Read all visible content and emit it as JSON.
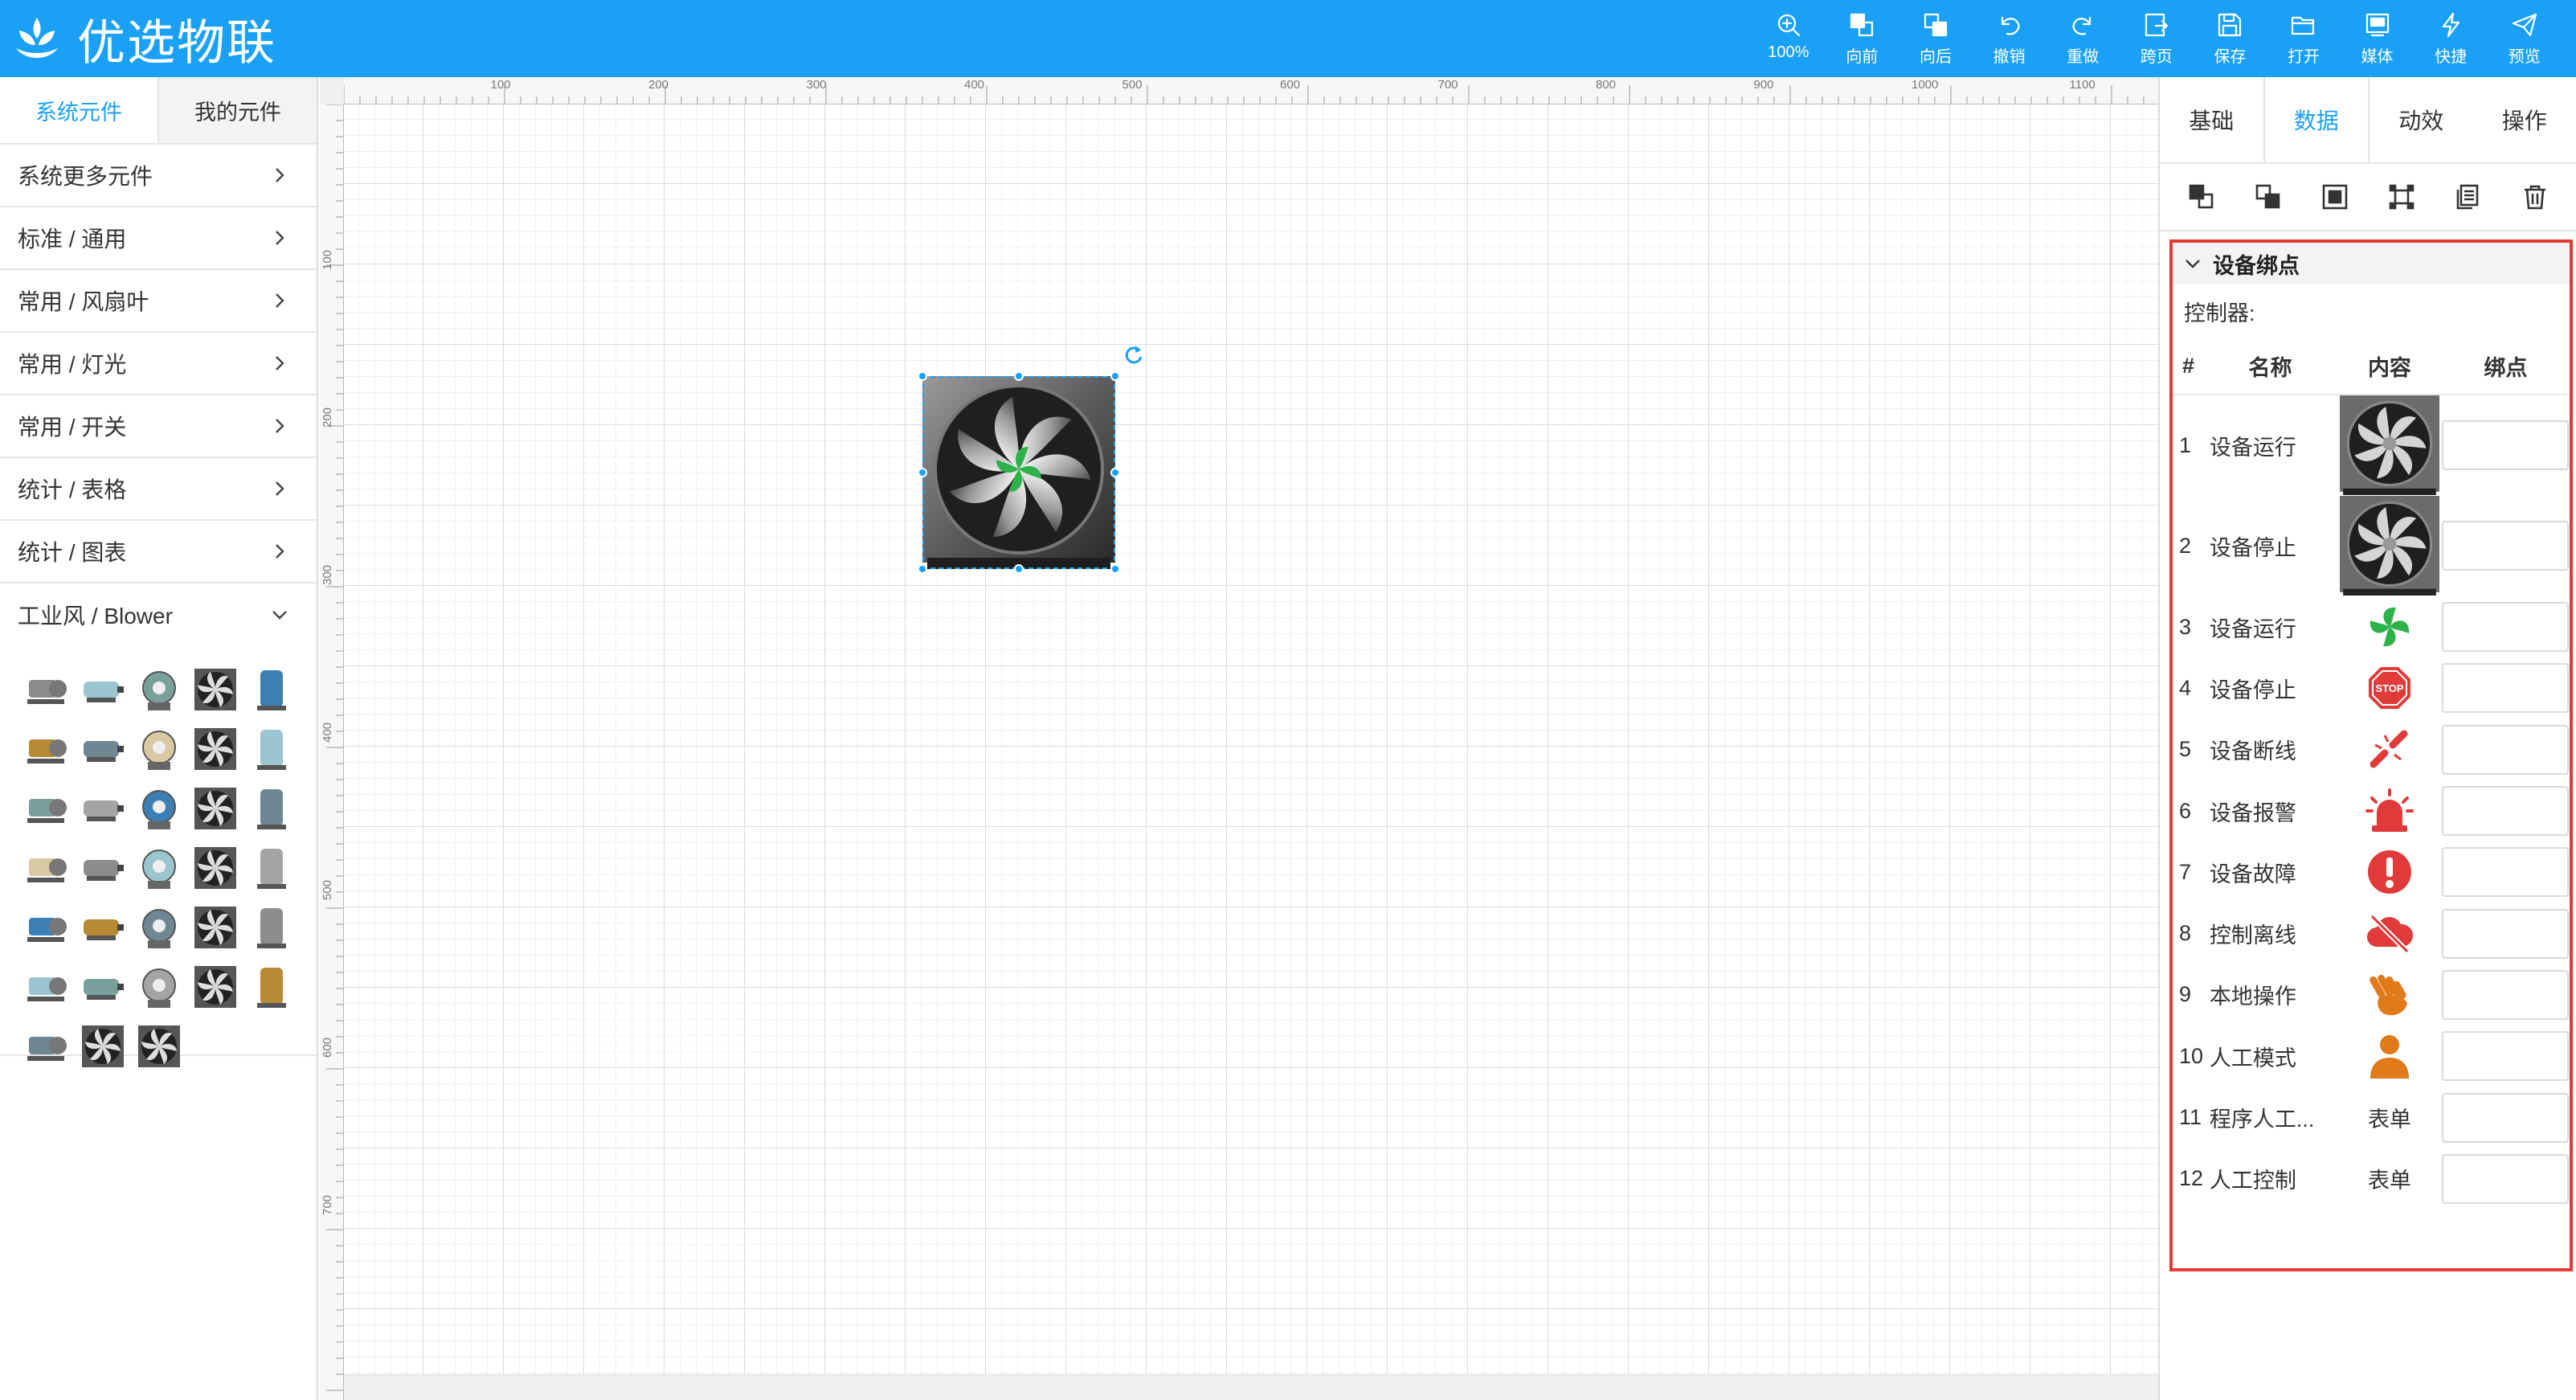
{
  "header": {
    "app_title": "优选物联",
    "toolbar": [
      {
        "name": "zoom",
        "label": "100%",
        "icon": "zoom-icon"
      },
      {
        "name": "forward",
        "label": "向前",
        "icon": "bring-forward-icon"
      },
      {
        "name": "backward",
        "label": "向后",
        "icon": "send-backward-icon"
      },
      {
        "name": "undo",
        "label": "撤销",
        "icon": "undo-icon"
      },
      {
        "name": "redo",
        "label": "重做",
        "icon": "redo-icon"
      },
      {
        "name": "crosspage",
        "label": "跨页",
        "icon": "cross-page-icon"
      },
      {
        "name": "save",
        "label": "保存",
        "icon": "save-icon"
      },
      {
        "name": "open",
        "label": "打开",
        "icon": "folder-open-icon"
      },
      {
        "name": "media",
        "label": "媒体",
        "icon": "media-icon"
      },
      {
        "name": "shortcut",
        "label": "快捷",
        "icon": "lightning-icon"
      },
      {
        "name": "preview",
        "label": "预览",
        "icon": "send-icon"
      }
    ]
  },
  "sidebar": {
    "tabs": [
      {
        "label": "系统元件",
        "active": true
      },
      {
        "label": "我的元件",
        "active": false
      }
    ],
    "categories": [
      {
        "label": "系统更多元件",
        "expanded": false
      },
      {
        "label": "标准 / 通用",
        "expanded": false
      },
      {
        "label": "常用 / 风扇叶",
        "expanded": false
      },
      {
        "label": "常用 / 灯光",
        "expanded": false
      },
      {
        "label": "常用 / 开关",
        "expanded": false
      },
      {
        "label": "统计 / 表格",
        "expanded": false
      },
      {
        "label": "统计 / 图表",
        "expanded": false
      },
      {
        "label": "工业风 / Blower",
        "expanded": true
      }
    ],
    "blower_component_count": 33
  },
  "canvas": {
    "ruler_top": [
      "100",
      "200",
      "300",
      "400",
      "500",
      "600",
      "700",
      "800",
      "900",
      "1000",
      "1100"
    ],
    "ruler_left": [
      "100",
      "200",
      "300",
      "400",
      "500",
      "600",
      "700"
    ],
    "selected_component": "fan-blower"
  },
  "panel": {
    "tabs": [
      {
        "label": "基础",
        "active": false
      },
      {
        "label": "数据",
        "active": true
      },
      {
        "label": "动效",
        "active": false
      },
      {
        "label": "操作",
        "active": false
      }
    ],
    "tools": [
      "bring-front-icon",
      "send-back-icon",
      "group-icon",
      "ungroup-icon",
      "copy-icon",
      "delete-icon"
    ],
    "binding": {
      "section_title": "设备绑点",
      "controller_label": "控制器:",
      "columns": {
        "num": "#",
        "name": "名称",
        "content": "内容",
        "bind": "绑点"
      },
      "rows": [
        {
          "num": "1",
          "name": "设备运行",
          "content_type": "image",
          "icon": "fan-image-icon",
          "bind": ""
        },
        {
          "num": "2",
          "name": "设备停止",
          "content_type": "image",
          "icon": "fan-image-icon",
          "bind": ""
        },
        {
          "num": "3",
          "name": "设备运行",
          "content_type": "icon",
          "icon": "running-icon",
          "color": "#2db24a",
          "bind": ""
        },
        {
          "num": "4",
          "name": "设备停止",
          "content_type": "icon",
          "icon": "stop-sign-icon",
          "color": "#e03a3a",
          "bind": ""
        },
        {
          "num": "5",
          "name": "设备断线",
          "content_type": "icon",
          "icon": "broken-link-icon",
          "color": "#e03a3a",
          "bind": ""
        },
        {
          "num": "6",
          "name": "设备报警",
          "content_type": "icon",
          "icon": "alarm-icon",
          "color": "#e03a3a",
          "bind": ""
        },
        {
          "num": "7",
          "name": "设备故障",
          "content_type": "icon",
          "icon": "fault-icon",
          "color": "#e03a3a",
          "bind": ""
        },
        {
          "num": "8",
          "name": "控制离线",
          "content_type": "icon",
          "icon": "offline-cloud-icon",
          "color": "#e03a3a",
          "bind": ""
        },
        {
          "num": "9",
          "name": "本地操作",
          "content_type": "icon",
          "icon": "hand-icon",
          "color": "#e07a1a",
          "bind": ""
        },
        {
          "num": "10",
          "name": "人工模式",
          "content_type": "icon",
          "icon": "person-icon",
          "color": "#e07a1a",
          "bind": ""
        },
        {
          "num": "11",
          "name": "程序人工...",
          "content_type": "text",
          "content_text": "表单",
          "bind": ""
        },
        {
          "num": "12",
          "name": "人工控制",
          "content_type": "text",
          "content_text": "表单",
          "bind": ""
        }
      ]
    }
  },
  "colors": {
    "brand": "#1aa1f5",
    "highlight_border": "#e53a2f",
    "running_green": "#2db24a",
    "alarm_red": "#e03a3a",
    "manual_orange": "#e07a1a"
  }
}
